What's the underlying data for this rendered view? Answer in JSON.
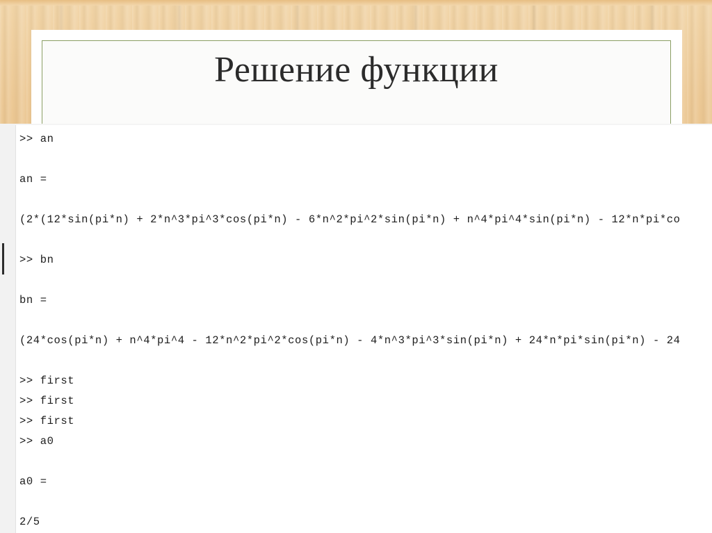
{
  "slide": {
    "title": "Решение функции",
    "border_color": "#8a9e63",
    "panel_color": "#ffffff",
    "background_color": "#e4b878",
    "title_color": "#2b2b2b"
  },
  "console": {
    "prompt": ">>",
    "font_color": "#1d1d1d",
    "background_color": "#ffffff",
    "gutter_color": "#f2f2f2",
    "lines": [
      ">> an",
      "",
      "an =",
      "",
      "(2*(12*sin(pi*n) + 2*n^3*pi^3*cos(pi*n) - 6*n^2*pi^2*sin(pi*n) + n^4*pi^4*sin(pi*n) - 12*n*pi*co",
      "",
      ">> bn",
      "",
      "bn =",
      "",
      "(24*cos(pi*n) + n^4*pi^4 - 12*n^2*pi^2*cos(pi*n) - 4*n^3*pi^3*sin(pi*n) + 24*n*pi*sin(pi*n) - 24",
      "",
      ">> first",
      ">> first",
      ">> first",
      ">> a0",
      "",
      "a0 =",
      "",
      "2/5"
    ]
  }
}
